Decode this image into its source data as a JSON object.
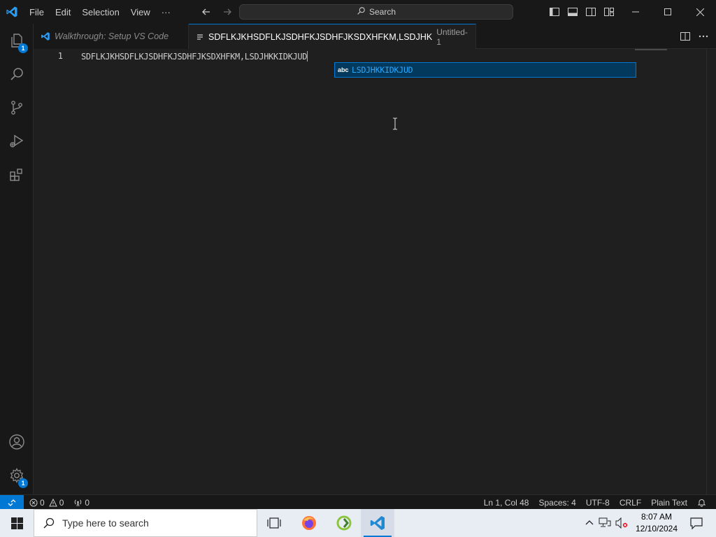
{
  "titlebar": {
    "menu": [
      "File",
      "Edit",
      "Selection",
      "View",
      "···"
    ],
    "search_label": "Search"
  },
  "activitybar": {
    "explorer_badge": "1",
    "manage_badge": "1"
  },
  "tabs": [
    {
      "label": "Walkthrough: Setup VS Code",
      "description": ""
    },
    {
      "label": "SDFLKJKHSDFLKJSDHFKJSDHFJKSDXHFKM,LSDJHK",
      "description": "Untitled-1",
      "dirty": true
    }
  ],
  "editor": {
    "line_number": "1",
    "line_text": "SDFLKJKHSDFLKJSDHFKJSDHFJKSDXHFKM,LSDJHKKIDKJUD",
    "suggestion": {
      "kind": "abc",
      "label": "LSDJHKKIDKJUD"
    }
  },
  "statusbar": {
    "errors": "0",
    "warnings": "0",
    "ports": "0",
    "position": "Ln 1, Col 48",
    "spaces": "Spaces: 4",
    "encoding": "UTF-8",
    "eol": "CRLF",
    "language": "Plain Text"
  },
  "taskbar": {
    "search_placeholder": "Type here to search",
    "time": "8:07 AM",
    "date": "12/10/2024"
  },
  "colors": {
    "accent": "#0078d4",
    "suggest_highlight": "#2aaaff",
    "editor_bg": "#1f1f1f",
    "chrome_bg": "#181818"
  },
  "icons": [
    "vscode-logo-icon",
    "arrow-left-icon",
    "arrow-right-icon",
    "search-icon",
    "toggle-sidebar-icon",
    "toggle-panel-icon",
    "toggle-secondary-sidebar-icon",
    "customize-layout-icon",
    "minimize-icon",
    "maximize-icon",
    "close-icon",
    "files-icon",
    "search-icon",
    "source-control-icon",
    "run-debug-icon",
    "extensions-icon",
    "account-icon",
    "gear-icon",
    "split-editor-icon",
    "more-actions-icon",
    "remote-icon",
    "error-icon",
    "warning-icon",
    "broadcast-icon",
    "bell-icon",
    "windows-start-icon",
    "task-view-icon",
    "firefox-icon",
    "app-icon",
    "chevron-up-icon",
    "network-icon",
    "speaker-muted-icon",
    "notifications-icon"
  ]
}
